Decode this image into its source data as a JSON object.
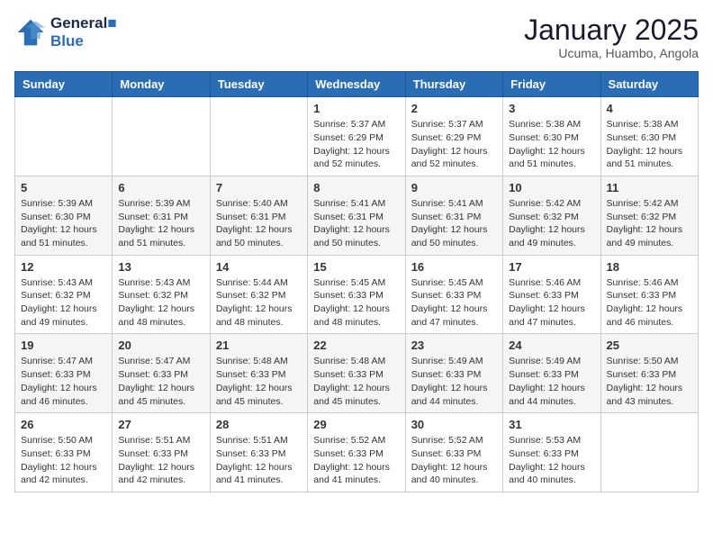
{
  "header": {
    "logo_line1": "General",
    "logo_line2": "Blue",
    "month": "January 2025",
    "location": "Ucuma, Huambo, Angola"
  },
  "days_of_week": [
    "Sunday",
    "Monday",
    "Tuesday",
    "Wednesday",
    "Thursday",
    "Friday",
    "Saturday"
  ],
  "weeks": [
    [
      {
        "day": "",
        "info": ""
      },
      {
        "day": "",
        "info": ""
      },
      {
        "day": "",
        "info": ""
      },
      {
        "day": "1",
        "info": "Sunrise: 5:37 AM\nSunset: 6:29 PM\nDaylight: 12 hours and 52 minutes."
      },
      {
        "day": "2",
        "info": "Sunrise: 5:37 AM\nSunset: 6:29 PM\nDaylight: 12 hours and 52 minutes."
      },
      {
        "day": "3",
        "info": "Sunrise: 5:38 AM\nSunset: 6:30 PM\nDaylight: 12 hours and 51 minutes."
      },
      {
        "day": "4",
        "info": "Sunrise: 5:38 AM\nSunset: 6:30 PM\nDaylight: 12 hours and 51 minutes."
      }
    ],
    [
      {
        "day": "5",
        "info": "Sunrise: 5:39 AM\nSunset: 6:30 PM\nDaylight: 12 hours and 51 minutes."
      },
      {
        "day": "6",
        "info": "Sunrise: 5:39 AM\nSunset: 6:31 PM\nDaylight: 12 hours and 51 minutes."
      },
      {
        "day": "7",
        "info": "Sunrise: 5:40 AM\nSunset: 6:31 PM\nDaylight: 12 hours and 50 minutes."
      },
      {
        "day": "8",
        "info": "Sunrise: 5:41 AM\nSunset: 6:31 PM\nDaylight: 12 hours and 50 minutes."
      },
      {
        "day": "9",
        "info": "Sunrise: 5:41 AM\nSunset: 6:31 PM\nDaylight: 12 hours and 50 minutes."
      },
      {
        "day": "10",
        "info": "Sunrise: 5:42 AM\nSunset: 6:32 PM\nDaylight: 12 hours and 49 minutes."
      },
      {
        "day": "11",
        "info": "Sunrise: 5:42 AM\nSunset: 6:32 PM\nDaylight: 12 hours and 49 minutes."
      }
    ],
    [
      {
        "day": "12",
        "info": "Sunrise: 5:43 AM\nSunset: 6:32 PM\nDaylight: 12 hours and 49 minutes."
      },
      {
        "day": "13",
        "info": "Sunrise: 5:43 AM\nSunset: 6:32 PM\nDaylight: 12 hours and 48 minutes."
      },
      {
        "day": "14",
        "info": "Sunrise: 5:44 AM\nSunset: 6:32 PM\nDaylight: 12 hours and 48 minutes."
      },
      {
        "day": "15",
        "info": "Sunrise: 5:45 AM\nSunset: 6:33 PM\nDaylight: 12 hours and 48 minutes."
      },
      {
        "day": "16",
        "info": "Sunrise: 5:45 AM\nSunset: 6:33 PM\nDaylight: 12 hours and 47 minutes."
      },
      {
        "day": "17",
        "info": "Sunrise: 5:46 AM\nSunset: 6:33 PM\nDaylight: 12 hours and 47 minutes."
      },
      {
        "day": "18",
        "info": "Sunrise: 5:46 AM\nSunset: 6:33 PM\nDaylight: 12 hours and 46 minutes."
      }
    ],
    [
      {
        "day": "19",
        "info": "Sunrise: 5:47 AM\nSunset: 6:33 PM\nDaylight: 12 hours and 46 minutes."
      },
      {
        "day": "20",
        "info": "Sunrise: 5:47 AM\nSunset: 6:33 PM\nDaylight: 12 hours and 45 minutes."
      },
      {
        "day": "21",
        "info": "Sunrise: 5:48 AM\nSunset: 6:33 PM\nDaylight: 12 hours and 45 minutes."
      },
      {
        "day": "22",
        "info": "Sunrise: 5:48 AM\nSunset: 6:33 PM\nDaylight: 12 hours and 45 minutes."
      },
      {
        "day": "23",
        "info": "Sunrise: 5:49 AM\nSunset: 6:33 PM\nDaylight: 12 hours and 44 minutes."
      },
      {
        "day": "24",
        "info": "Sunrise: 5:49 AM\nSunset: 6:33 PM\nDaylight: 12 hours and 44 minutes."
      },
      {
        "day": "25",
        "info": "Sunrise: 5:50 AM\nSunset: 6:33 PM\nDaylight: 12 hours and 43 minutes."
      }
    ],
    [
      {
        "day": "26",
        "info": "Sunrise: 5:50 AM\nSunset: 6:33 PM\nDaylight: 12 hours and 42 minutes."
      },
      {
        "day": "27",
        "info": "Sunrise: 5:51 AM\nSunset: 6:33 PM\nDaylight: 12 hours and 42 minutes."
      },
      {
        "day": "28",
        "info": "Sunrise: 5:51 AM\nSunset: 6:33 PM\nDaylight: 12 hours and 41 minutes."
      },
      {
        "day": "29",
        "info": "Sunrise: 5:52 AM\nSunset: 6:33 PM\nDaylight: 12 hours and 41 minutes."
      },
      {
        "day": "30",
        "info": "Sunrise: 5:52 AM\nSunset: 6:33 PM\nDaylight: 12 hours and 40 minutes."
      },
      {
        "day": "31",
        "info": "Sunrise: 5:53 AM\nSunset: 6:33 PM\nDaylight: 12 hours and 40 minutes."
      },
      {
        "day": "",
        "info": ""
      }
    ]
  ]
}
